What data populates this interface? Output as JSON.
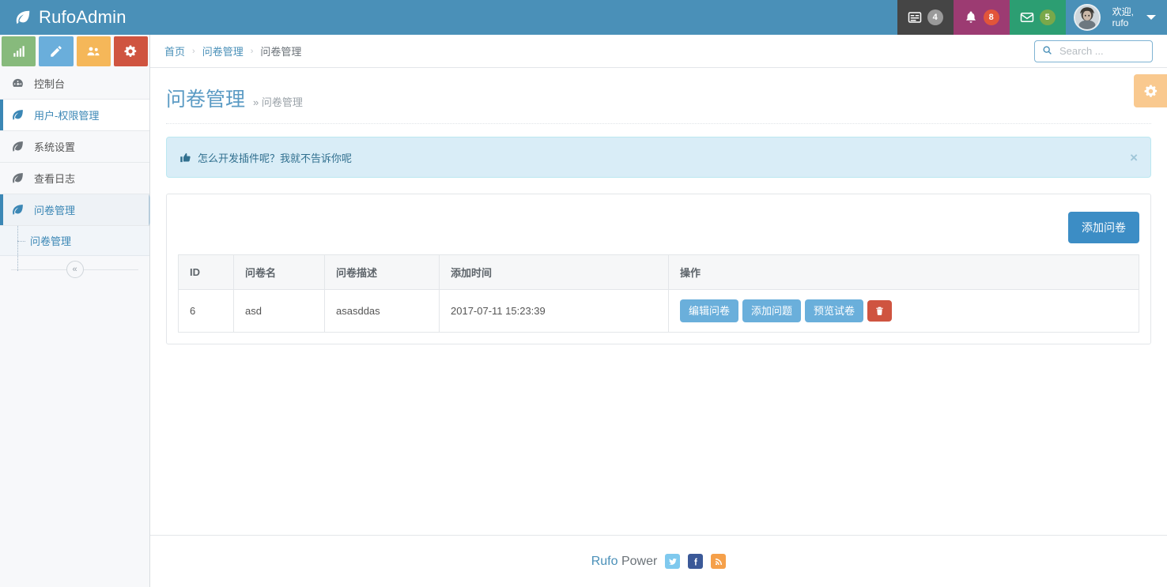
{
  "app": {
    "brand": "RufoAdmin",
    "brand_icon": "leaf-icon"
  },
  "header": {
    "tasks": {
      "icon": "tasks-icon",
      "badge": "4"
    },
    "notifications": {
      "icon": "bell-icon",
      "badge": "8"
    },
    "messages": {
      "icon": "envelope-icon",
      "badge": "5"
    },
    "user": {
      "avatar": "user-avatar",
      "greeting": "欢迎,",
      "username": "rufo",
      "caret": "chevron-down-icon"
    }
  },
  "quick_tiles": [
    {
      "name": "chart-tile",
      "icon": "bar-chart-icon",
      "color": "#87ba7c"
    },
    {
      "name": "edit-tile",
      "icon": "pencil-icon",
      "color": "#6aaedb"
    },
    {
      "name": "users-tile",
      "icon": "users-icon",
      "color": "#f5b759"
    },
    {
      "name": "settings-tile",
      "icon": "cogs-icon",
      "color": "#cf5440"
    }
  ],
  "sidebar": {
    "items": [
      {
        "label": "控制台",
        "icon": "dashboard-icon",
        "state": "normal"
      },
      {
        "label": "用户-权限管理",
        "icon": "leaf-icon",
        "state": "highlight"
      },
      {
        "label": "系统设置",
        "icon": "leaf-icon",
        "state": "normal"
      },
      {
        "label": "查看日志",
        "icon": "leaf-icon",
        "state": "normal"
      },
      {
        "label": "问卷管理",
        "icon": "leaf-icon",
        "state": "active"
      }
    ],
    "subitems": [
      {
        "label": "问卷管理"
      }
    ],
    "collapse": {
      "icon": "chevron-double-left-icon",
      "glyph": "«"
    }
  },
  "breadcrumb": {
    "items": [
      {
        "label": "首页",
        "current": false
      },
      {
        "label": "问卷管理",
        "current": false
      },
      {
        "label": "问卷管理",
        "current": true
      }
    ],
    "separator": "›"
  },
  "search": {
    "icon": "search-icon",
    "value": "",
    "placeholder": "Search ..."
  },
  "page": {
    "title": "问卷管理",
    "subtitle": "» 问卷管理"
  },
  "alert": {
    "icon": "thumbs-up-icon",
    "text": "怎么开发插件呢？我就不告诉你呢",
    "close": "×"
  },
  "toolbar": {
    "add_label": "添加问卷"
  },
  "table": {
    "columns": [
      "ID",
      "问卷名",
      "问卷描述",
      "添加时间",
      "操作"
    ],
    "rows": [
      {
        "id": "6",
        "name": "asd",
        "description": "asasddas",
        "created": "2017-07-11 15:23:39",
        "actions": [
          {
            "label": "编辑问卷",
            "style": "light"
          },
          {
            "label": "添加问题",
            "style": "light"
          },
          {
            "label": "预览试卷",
            "style": "light"
          }
        ],
        "delete": {
          "icon": "trash-icon"
        }
      }
    ]
  },
  "gear_tab": {
    "icon": "gear-icon"
  },
  "footer": {
    "brand_primary": "Rufo",
    "brand_secondary": "Power",
    "social": [
      {
        "name": "twitter-icon",
        "color": "#7fc9ee"
      },
      {
        "name": "facebook-icon",
        "color": "#3b5998"
      },
      {
        "name": "rss-icon",
        "color": "#f5a04a"
      }
    ]
  },
  "colors": {
    "header_blue": "#4a90b8",
    "accent": "#3c8dc5",
    "alert_bg": "#d9edf7",
    "danger": "#cf5440"
  }
}
